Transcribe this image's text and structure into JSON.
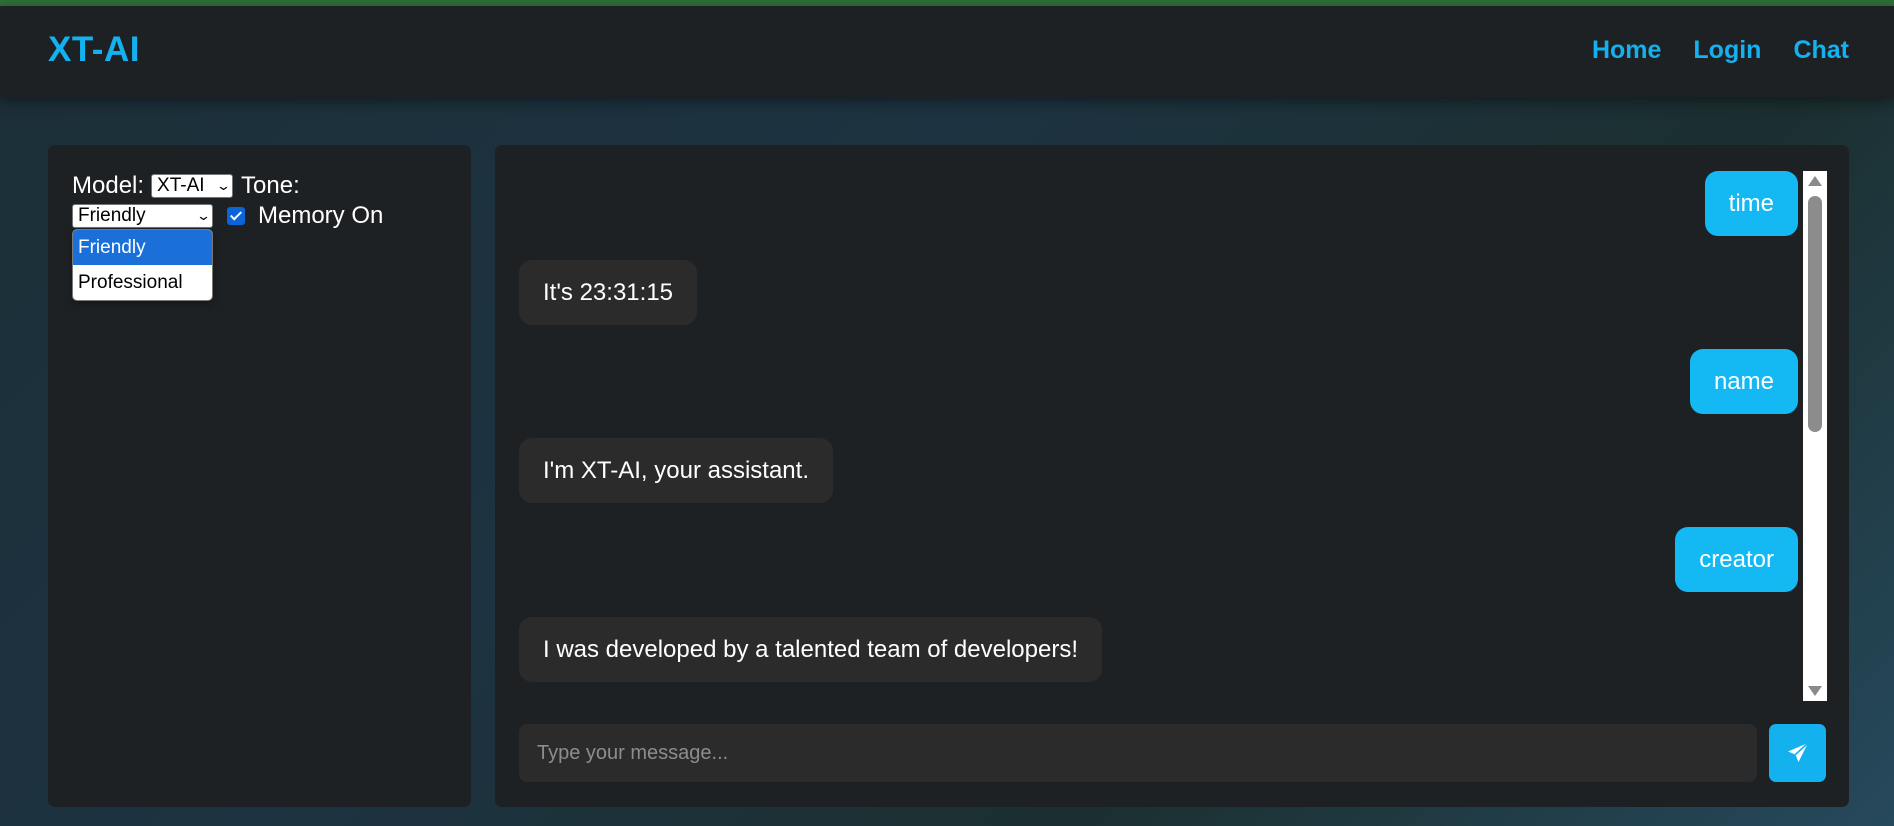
{
  "navbar": {
    "brand": "XT-AI",
    "links": [
      "Home",
      "Login",
      "Chat"
    ]
  },
  "settings": {
    "model_label": "Model:",
    "model_value": "XT-AI",
    "tone_label": "Tone:",
    "tone_value": "Friendly",
    "tone_options": [
      "Friendly",
      "Professional"
    ],
    "memory_checked": true,
    "memory_label": "Memory On"
  },
  "chat": {
    "messages": [
      {
        "role": "user",
        "text": "time"
      },
      {
        "role": "bot",
        "text": "It's 23:31:15"
      },
      {
        "role": "user",
        "text": "name"
      },
      {
        "role": "bot",
        "text": "I'm XT-AI, your assistant."
      },
      {
        "role": "user",
        "text": "creator"
      },
      {
        "role": "bot",
        "text": "I was developed by a talented team of developers!"
      }
    ],
    "input_placeholder": "Type your message...",
    "input_value": ""
  },
  "icons": {
    "send": "paper-plane-icon",
    "dropdown": "chevron-down-icon",
    "checkbox": "checkmark-icon"
  },
  "colors": {
    "accent": "#14b1f0",
    "user_bubble": "#14b9f4",
    "bot_bubble": "#2b2b2b",
    "panel": "#1e2123",
    "selected_option": "#1a6fd9"
  }
}
